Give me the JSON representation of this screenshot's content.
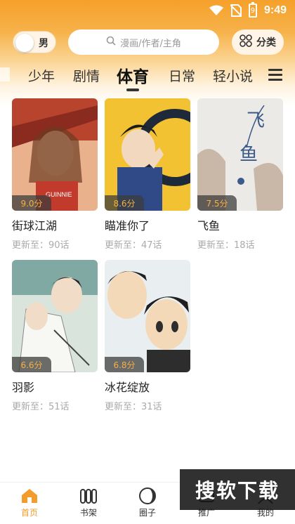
{
  "status_bar": {
    "time": "9:49",
    "battery_level": "9"
  },
  "header": {
    "gender_label": "男",
    "search_placeholder": "漫画/作者/主角",
    "category_label": "分类"
  },
  "tabs": [
    {
      "label": "少年"
    },
    {
      "label": "剧情"
    },
    {
      "label": "体育",
      "active": true
    },
    {
      "label": "日常"
    },
    {
      "label": "轻小说"
    }
  ],
  "comics": [
    {
      "title": "街球江湖",
      "score": "9.0分",
      "update": "更新至：90话",
      "cover_colors": [
        "#b8442e",
        "#e07a4f",
        "#f0c6a0"
      ]
    },
    {
      "title": "瞄准你了",
      "score": "8.6分",
      "update": "更新至：47话",
      "cover_colors": [
        "#f2c232",
        "#2f4a86",
        "#e9d6a4"
      ]
    },
    {
      "title": "飞鱼",
      "score": "7.5分",
      "update": "更新至：18话",
      "cover_colors": [
        "#e8e6e2",
        "#c9b8a8",
        "#3b5b8a"
      ]
    },
    {
      "title": "羽影",
      "score": "6.6分",
      "update": "更新至：51话",
      "cover_colors": [
        "#7fa9a2",
        "#d9e4dc",
        "#3a3a3a"
      ]
    },
    {
      "title": "冰花绽放",
      "score": "6.8分",
      "update": "更新至：31话",
      "cover_colors": [
        "#e9eef0",
        "#f4d9b8",
        "#2d2d2d"
      ]
    }
  ],
  "bottom_nav": [
    {
      "label": "首页",
      "icon": "home-icon",
      "active": true
    },
    {
      "label": "书架",
      "icon": "bookshelf-icon"
    },
    {
      "label": "圈子",
      "icon": "circle-icon"
    },
    {
      "label": "推广",
      "icon": "promo-icon"
    },
    {
      "label": "我的",
      "icon": "profile-icon"
    }
  ],
  "watermark": "搜软下载",
  "colors": {
    "accent": "#f39c2b",
    "header_gradient_top": "#f5a02a"
  }
}
